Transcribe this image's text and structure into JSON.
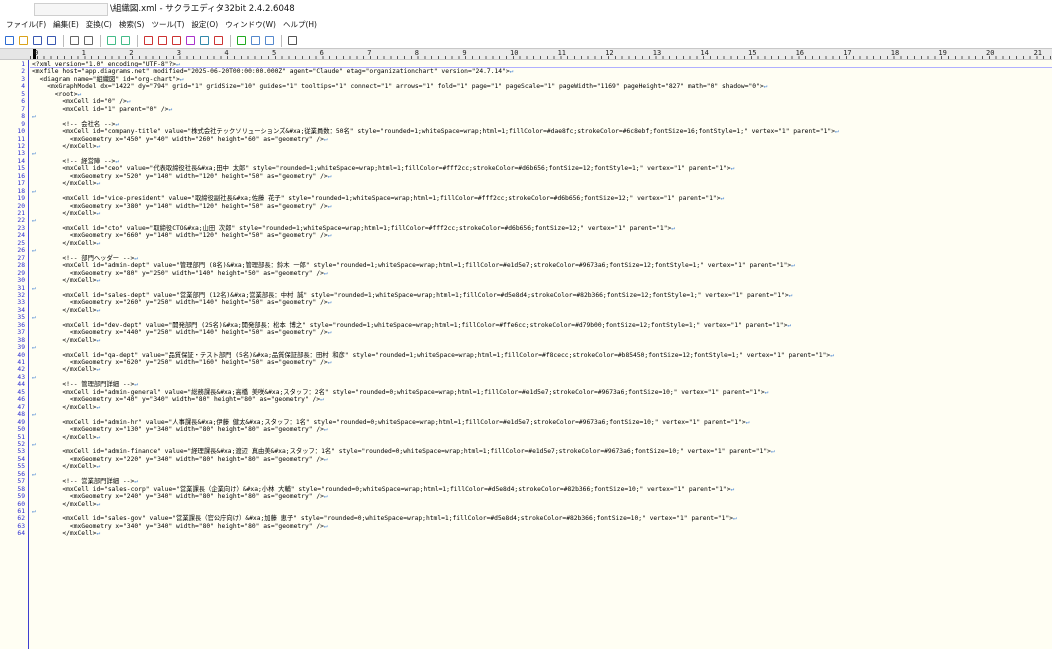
{
  "window": {
    "title": "\\組織図.xml - サクラエディタ32bit 2.4.2.6048"
  },
  "menu": [
    "ファイル(F)",
    "編集(E)",
    "変換(C)",
    "検索(S)",
    "ツール(T)",
    "設定(O)",
    "ウィンドウ(W)",
    "ヘルプ(H)"
  ],
  "toolbar_icons": [
    "new-file-icon",
    "open-folder-icon",
    "save-icon",
    "save-all-icon",
    "separator",
    "undo-icon",
    "redo-icon",
    "separator",
    "jump-back-icon",
    "jump-forward-icon",
    "separator",
    "search-icon",
    "search-next-icon",
    "search-prev-icon",
    "replace-icon",
    "grep-icon",
    "tag-jump-icon",
    "separator",
    "outline-icon",
    "split-window-icon",
    "compare-icon",
    "separator",
    "settings-icon"
  ],
  "ruler": {
    "labels": [
      "0",
      "1",
      "2",
      "3",
      "4",
      "5",
      "6",
      "7",
      "8",
      "9",
      "10",
      "11",
      "12",
      "13",
      "14",
      "15",
      "16",
      "17",
      "18",
      "19",
      "20",
      "21"
    ]
  },
  "eol_mark": "↵",
  "lines": [
    "<?xml version=\"1.0\" encoding=\"UTF-8\"?>",
    "<mxfile host=\"app.diagrams.net\" modified=\"2025-06-20T00:00:00.000Z\" agent=\"Claude\" etag=\"organizationchart\" version=\"24.7.14\">",
    "  <diagram name=\"組織図\" id=\"org-chart\">",
    "    <mxGraphModel dx=\"1422\" dy=\"794\" grid=\"1\" gridSize=\"10\" guides=\"1\" tooltips=\"1\" connect=\"1\" arrows=\"1\" fold=\"1\" page=\"1\" pageScale=\"1\" pageWidth=\"1169\" pageHeight=\"827\" math=\"0\" shadow=\"0\">",
    "      <root>",
    "        <mxCell id=\"0\" />",
    "        <mxCell id=\"1\" parent=\"0\" />",
    "",
    "        <!-- 会社名 -->",
    "        <mxCell id=\"company-title\" value=\"株式会社テックソリューションズ&#xa;従業員数：50名\" style=\"rounded=1;whiteSpace=wrap;html=1;fillColor=#dae8fc;strokeColor=#6c8ebf;fontSize=16;fontStyle=1;\" vertex=\"1\" parent=\"1\">",
    "          <mxGeometry x=\"450\" y=\"40\" width=\"260\" height=\"60\" as=\"geometry\" />",
    "        </mxCell>",
    "",
    "        <!-- 経営陣 -->",
    "        <mxCell id=\"ceo\" value=\"代表取締役社長&#xa;田中 太郎\" style=\"rounded=1;whiteSpace=wrap;html=1;fillColor=#fff2cc;strokeColor=#d6b656;fontSize=12;fontStyle=1;\" vertex=\"1\" parent=\"1\">",
    "          <mxGeometry x=\"520\" y=\"140\" width=\"120\" height=\"50\" as=\"geometry\" />",
    "        </mxCell>",
    "",
    "        <mxCell id=\"vice-president\" value=\"取締役副社長&#xa;佐藤 花子\" style=\"rounded=1;whiteSpace=wrap;html=1;fillColor=#fff2cc;strokeColor=#d6b656;fontSize=12;\" vertex=\"1\" parent=\"1\">",
    "          <mxGeometry x=\"380\" y=\"140\" width=\"120\" height=\"50\" as=\"geometry\" />",
    "        </mxCell>",
    "",
    "        <mxCell id=\"cto\" value=\"取締役CTO&#xa;山田 次郎\" style=\"rounded=1;whiteSpace=wrap;html=1;fillColor=#fff2cc;strokeColor=#d6b656;fontSize=12;\" vertex=\"1\" parent=\"1\">",
    "          <mxGeometry x=\"660\" y=\"140\" width=\"120\" height=\"50\" as=\"geometry\" />",
    "        </mxCell>",
    "",
    "        <!-- 部門ヘッダー -->",
    "        <mxCell id=\"admin-dept\" value=\"管理部門 (8名)&#xa;管理部長：鈴木 一郎\" style=\"rounded=1;whiteSpace=wrap;html=1;fillColor=#e1d5e7;strokeColor=#9673a6;fontSize=12;fontStyle=1;\" vertex=\"1\" parent=\"1\">",
    "          <mxGeometry x=\"80\" y=\"250\" width=\"140\" height=\"50\" as=\"geometry\" />",
    "        </mxCell>",
    "",
    "        <mxCell id=\"sales-dept\" value=\"営業部門 (12名)&#xa;営業部長：中村 誠\" style=\"rounded=1;whiteSpace=wrap;html=1;fillColor=#d5e8d4;strokeColor=#82b366;fontSize=12;fontStyle=1;\" vertex=\"1\" parent=\"1\">",
    "          <mxGeometry x=\"260\" y=\"250\" width=\"140\" height=\"50\" as=\"geometry\" />",
    "        </mxCell>",
    "",
    "        <mxCell id=\"dev-dept\" value=\"開発部門 (25名)&#xa;開発部長：松本 博之\" style=\"rounded=1;whiteSpace=wrap;html=1;fillColor=#ffe6cc;strokeColor=#d79b00;fontSize=12;fontStyle=1;\" vertex=\"1\" parent=\"1\">",
    "          <mxGeometry x=\"440\" y=\"250\" width=\"140\" height=\"50\" as=\"geometry\" />",
    "        </mxCell>",
    "",
    "        <mxCell id=\"qa-dept\" value=\"品質保証・テスト部門 (5名)&#xa;品質保証部長：田村 和彦\" style=\"rounded=1;whiteSpace=wrap;html=1;fillColor=#f8cecc;strokeColor=#b85450;fontSize=12;fontStyle=1;\" vertex=\"1\" parent=\"1\">",
    "          <mxGeometry x=\"620\" y=\"250\" width=\"160\" height=\"50\" as=\"geometry\" />",
    "        </mxCell>",
    "",
    "        <!-- 管理部門詳細 -->",
    "        <mxCell id=\"admin-general\" value=\"総務課長&#xa;高橋 美咲&#xa;スタッフ：2名\" style=\"rounded=0;whiteSpace=wrap;html=1;fillColor=#e1d5e7;strokeColor=#9673a6;fontSize=10;\" vertex=\"1\" parent=\"1\">",
    "          <mxGeometry x=\"40\" y=\"340\" width=\"80\" height=\"80\" as=\"geometry\" />",
    "        </mxCell>",
    "",
    "        <mxCell id=\"admin-hr\" value=\"人事課長&#xa;伊藤 健太&#xa;スタッフ：1名\" style=\"rounded=0;whiteSpace=wrap;html=1;fillColor=#e1d5e7;strokeColor=#9673a6;fontSize=10;\" vertex=\"1\" parent=\"1\">",
    "          <mxGeometry x=\"130\" y=\"340\" width=\"80\" height=\"80\" as=\"geometry\" />",
    "        </mxCell>",
    "",
    "        <mxCell id=\"admin-finance\" value=\"経理課長&#xa;渡辺 真由美&#xa;スタッフ：1名\" style=\"rounded=0;whiteSpace=wrap;html=1;fillColor=#e1d5e7;strokeColor=#9673a6;fontSize=10;\" vertex=\"1\" parent=\"1\">",
    "          <mxGeometry x=\"220\" y=\"340\" width=\"80\" height=\"80\" as=\"geometry\" />",
    "        </mxCell>",
    "",
    "        <!-- 営業部門詳細 -->",
    "        <mxCell id=\"sales-corp\" value=\"営業課長（企業向け）&#xa;小林 大輔\" style=\"rounded=0;whiteSpace=wrap;html=1;fillColor=#d5e8d4;strokeColor=#82b366;fontSize=10;\" vertex=\"1\" parent=\"1\">",
    "          <mxGeometry x=\"240\" y=\"340\" width=\"80\" height=\"80\" as=\"geometry\" />",
    "        </mxCell>",
    "",
    "        <mxCell id=\"sales-gov\" value=\"営業課長（官公庁向け）&#xa;加藤 恵子\" style=\"rounded=0;whiteSpace=wrap;html=1;fillColor=#d5e8d4;strokeColor=#82b366;fontSize=10;\" vertex=\"1\" parent=\"1\">",
    "          <mxGeometry x=\"340\" y=\"340\" width=\"80\" height=\"80\" as=\"geometry\" />",
    "        </mxCell>"
  ],
  "colors": {
    "editor_bg": "#fffef3",
    "line_number": "#2a2ad0",
    "eol_mark": "#3f7fd0"
  }
}
